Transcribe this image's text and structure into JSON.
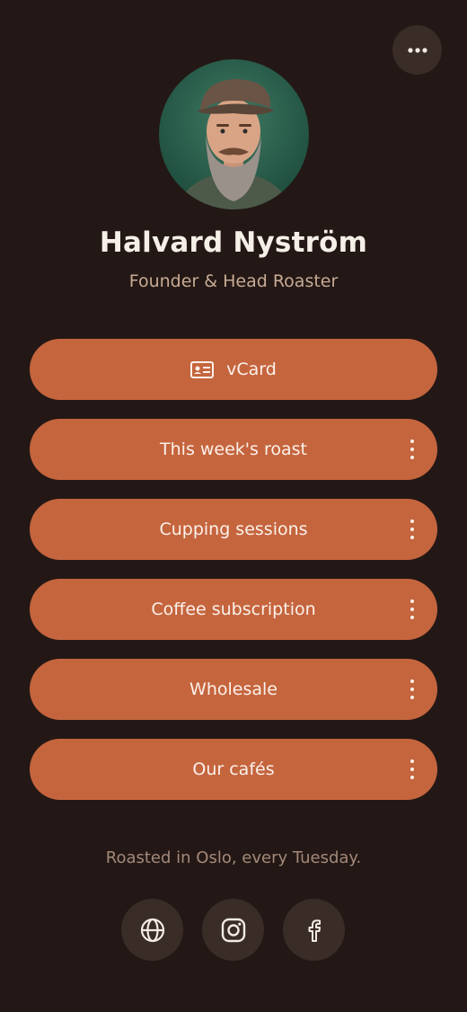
{
  "profile": {
    "name": "Halvard Nyström",
    "title": "Founder & Head Roaster"
  },
  "links": [
    {
      "label": "vCard",
      "icon": "contact-card-icon",
      "has_menu": false
    },
    {
      "label": "This week's roast",
      "has_menu": true
    },
    {
      "label": "Cupping sessions",
      "has_menu": true
    },
    {
      "label": "Coffee subscription",
      "has_menu": true
    },
    {
      "label": "Wholesale",
      "has_menu": true
    },
    {
      "label": "Our cafés",
      "has_menu": true
    }
  ],
  "tagline": "Roasted in Oslo, every Tuesday.",
  "socials": [
    {
      "icon": "globe-icon"
    },
    {
      "icon": "instagram-icon"
    },
    {
      "icon": "facebook-icon"
    }
  ],
  "colors": {
    "background": "#231815",
    "button": "#c5653e",
    "circle_button": "#3a2c27",
    "subtitle": "#c8ab95",
    "tagline": "#a3897a"
  }
}
